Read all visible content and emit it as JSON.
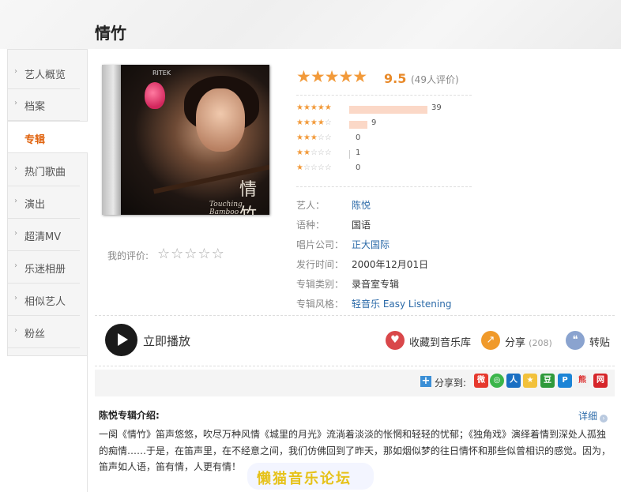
{
  "page": {
    "title": "情竹"
  },
  "sidebar": {
    "items": [
      {
        "label": "艺人概览"
      },
      {
        "label": "档案"
      },
      {
        "label": "专辑",
        "active": true
      },
      {
        "label": "热门歌曲"
      },
      {
        "label": "演出"
      },
      {
        "label": "超清MV"
      },
      {
        "label": "乐迷相册"
      },
      {
        "label": "相似艺人"
      },
      {
        "label": "粉丝"
      }
    ]
  },
  "cover": {
    "brand": "RITEK",
    "title_text": "情竹",
    "subtitle": "Touching Bamboo"
  },
  "my_rating": {
    "label": "我的评价:",
    "stars": "☆☆☆☆☆"
  },
  "rating": {
    "score": "9.5",
    "votes": "(49人评价)",
    "accent": "#f29a3a",
    "distribution": [
      {
        "stars": 5,
        "count": "39",
        "fraction": 0.796
      },
      {
        "stars": 4,
        "count": "9",
        "fraction": 0.184
      },
      {
        "stars": 3,
        "count": "0",
        "fraction": 0
      },
      {
        "stars": 2,
        "count": "1",
        "fraction": 0.02
      },
      {
        "stars": 1,
        "count": "0",
        "fraction": 0
      }
    ]
  },
  "info": [
    {
      "key": "艺人：",
      "value": "陈悦",
      "link": true
    },
    {
      "key": "语种：",
      "value": "国语",
      "link": false
    },
    {
      "key": "唱片公司：",
      "value": "正大国际",
      "link": true
    },
    {
      "key": "发行时间：",
      "value": "2000年12月01日",
      "link": false
    },
    {
      "key": "专辑类别：",
      "value": "录音室专辑",
      "link": false
    },
    {
      "key": "专辑风格：",
      "value": "轻音乐 Easy Listening",
      "link": true
    }
  ],
  "actions": {
    "play": "立即播放",
    "collect": "收藏到音乐库",
    "share": "分享",
    "share_count": "(208)",
    "repost": "转贴"
  },
  "share_bar": {
    "label": "分享到:",
    "icons": [
      "weibo-icon",
      "wechat-icon",
      "renren-icon",
      "qzone-icon",
      "douban-icon",
      "kaixin-icon",
      "tieba-icon",
      "netease-icon"
    ]
  },
  "intro": {
    "title": "陈悦专辑介绍:",
    "more": "详细",
    "text": "一阕《情竹》笛声悠悠，吹尽万种风情《城里的月光》流淌着淡淡的怅惘和轻轻的忧郁；《独角戏》演绎着情到深处人孤独的痴情……于是，在笛声里，在不经意之间，我们仿佛回到了昨天，那如烟似梦的往日情怀和那些似曾相识的感觉。因为，笛声如人语，笛有情，人更有情！"
  },
  "watermark": {
    "text": "懒猫音乐论坛"
  }
}
